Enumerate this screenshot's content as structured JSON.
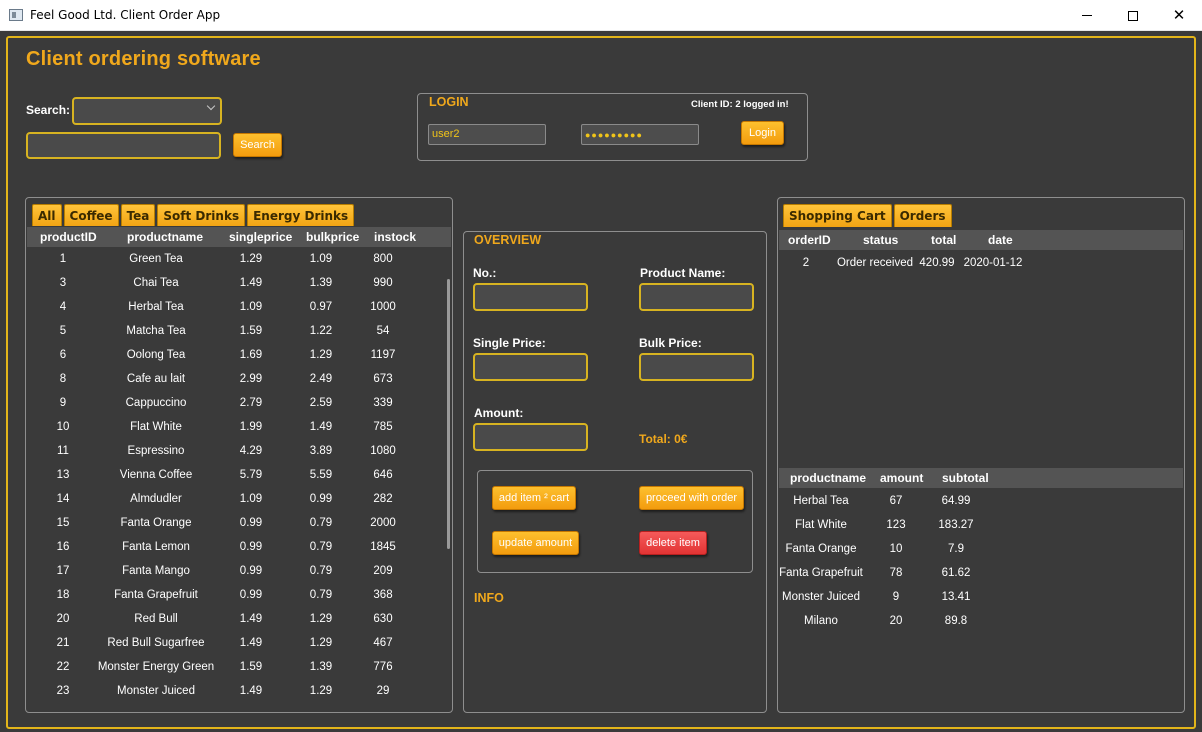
{
  "window": {
    "title": "Feel Good Ltd. Client Order App",
    "minimize_icon": "minimize-icon",
    "maximize_icon": "maximize-icon",
    "close_icon": "close-icon"
  },
  "app": {
    "heading": "Client ordering software",
    "accent_color": "#f0a81c",
    "border_color": "#e3b51a"
  },
  "search": {
    "label": "Search:",
    "select_value": "",
    "input_value": "",
    "button_label": "Search"
  },
  "login": {
    "title": "LOGIN",
    "status": "Client ID: 2 logged in!",
    "username": "user2",
    "password_mask": "●●●●●●●●●",
    "button_label": "Login"
  },
  "products": {
    "tabs": [
      "All",
      "Coffee",
      "Tea",
      "Soft Drinks",
      "Energy Drinks"
    ],
    "columns": [
      "productID",
      "productname",
      "singleprice",
      "bulkprice",
      "instock"
    ],
    "rows": [
      [
        "1",
        "Green Tea",
        "1.29",
        "1.09",
        "800"
      ],
      [
        "3",
        "Chai Tea",
        "1.49",
        "1.39",
        "990"
      ],
      [
        "4",
        "Herbal Tea",
        "1.09",
        "0.97",
        "1000"
      ],
      [
        "5",
        "Matcha Tea",
        "1.59",
        "1.22",
        "54"
      ],
      [
        "6",
        "Oolong Tea",
        "1.69",
        "1.29",
        "1197"
      ],
      [
        "8",
        "Cafe au lait",
        "2.99",
        "2.49",
        "673"
      ],
      [
        "9",
        "Cappuccino",
        "2.79",
        "2.59",
        "339"
      ],
      [
        "10",
        "Flat White",
        "1.99",
        "1.49",
        "785"
      ],
      [
        "11",
        "Espressino",
        "4.29",
        "3.89",
        "1080"
      ],
      [
        "13",
        "Vienna Coffee",
        "5.79",
        "5.59",
        "646"
      ],
      [
        "14",
        "Almdudler",
        "1.09",
        "0.99",
        "282"
      ],
      [
        "15",
        "Fanta Orange",
        "0.99",
        "0.79",
        "2000"
      ],
      [
        "16",
        "Fanta Lemon",
        "0.99",
        "0.79",
        "1845"
      ],
      [
        "17",
        "Fanta Mango",
        "0.99",
        "0.79",
        "209"
      ],
      [
        "18",
        "Fanta Grapefruit",
        "0.99",
        "0.79",
        "368"
      ],
      [
        "20",
        "Red Bull",
        "1.49",
        "1.29",
        "630"
      ],
      [
        "21",
        "Red Bull Sugarfree",
        "1.49",
        "1.29",
        "467"
      ],
      [
        "22",
        "Monster Energy Green",
        "1.59",
        "1.39",
        "776"
      ],
      [
        "23",
        "Monster Juiced",
        "1.49",
        "1.29",
        "29"
      ]
    ]
  },
  "overview": {
    "title": "OVERVIEW",
    "no_label": "No.:",
    "product_name_label": "Product Name:",
    "single_price_label": "Single Price:",
    "bulk_price_label": "Bulk Price:",
    "amount_label": "Amount:",
    "total": "Total: 0€",
    "add_button": "add item ² cart",
    "proceed_button": "proceed with order",
    "update_button": "update amount",
    "delete_button": "delete item",
    "info_title": "INFO"
  },
  "orders": {
    "tabs": [
      "Shopping Cart",
      "Orders"
    ],
    "columns": [
      "orderID",
      "status",
      "total",
      "date"
    ],
    "rows": [
      [
        "2",
        "Order received",
        "420.99",
        "2020-01-12"
      ]
    ]
  },
  "order_items": {
    "columns": [
      "productname",
      "amount",
      "subtotal"
    ],
    "rows": [
      [
        "Herbal Tea",
        "67",
        "64.99"
      ],
      [
        "Flat White",
        "123",
        "183.27"
      ],
      [
        "Fanta Orange",
        "10",
        "7.9"
      ],
      [
        "Fanta Grapefruit",
        "78",
        "61.62"
      ],
      [
        "Monster Juiced",
        "9",
        "13.41"
      ],
      [
        "Milano",
        "20",
        "89.8"
      ]
    ]
  }
}
